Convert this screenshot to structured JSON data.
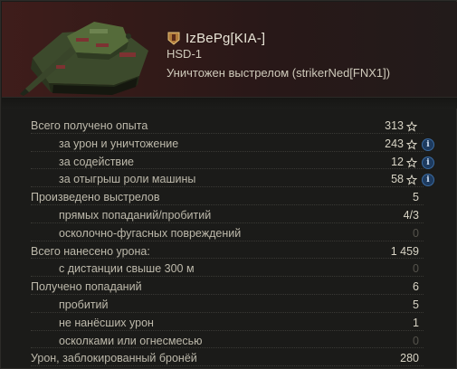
{
  "header": {
    "player_name": "IzBePg[KIA-]",
    "vehicle": "HSD-1",
    "destroyed_text": "Уничтожен выстрелом (strikerNed[FNX1])",
    "accent_color": "#3f1d1b",
    "icons": [
      "tank-image",
      "clan-emblem-icon"
    ]
  },
  "stats": [
    {
      "label": "Всего получено опыта",
      "value": "313",
      "level": 0,
      "star": true,
      "info": false
    },
    {
      "label": "за урон и уничтожение",
      "value": "243",
      "level": 1,
      "star": true,
      "info": true
    },
    {
      "label": "за содействие",
      "value": "12",
      "level": 1,
      "star": true,
      "info": true
    },
    {
      "label": "за отыгрыш роли машины",
      "value": "58",
      "level": 1,
      "star": true,
      "info": true
    },
    {
      "label": "Произведено выстрелов",
      "value": "5",
      "level": 0,
      "star": false,
      "info": false
    },
    {
      "label": "прямых попаданий/пробитий",
      "value": "4/3",
      "level": 1,
      "star": false,
      "info": false
    },
    {
      "label": "осколочно-фугасных повреждений",
      "value": "0",
      "level": 1,
      "star": false,
      "info": false,
      "dim": true
    },
    {
      "label": "Всего нанесено урона:",
      "value": "1 459",
      "level": 0,
      "star": false,
      "info": false
    },
    {
      "label": "с дистанции свыше 300 м",
      "value": "0",
      "level": 1,
      "star": false,
      "info": false,
      "dim": true
    },
    {
      "label": "Получено попаданий",
      "value": "6",
      "level": 0,
      "star": false,
      "info": false
    },
    {
      "label": "пробитий",
      "value": "5",
      "level": 1,
      "star": false,
      "info": false
    },
    {
      "label": "не нанёсших урон",
      "value": "1",
      "level": 1,
      "star": false,
      "info": false
    },
    {
      "label": "осколками или огнесмесью",
      "value": "0",
      "level": 1,
      "star": false,
      "info": false,
      "dim": true
    },
    {
      "label": "Урон, заблокированный бронёй",
      "value": "280",
      "level": 0,
      "star": false,
      "info": false
    }
  ]
}
